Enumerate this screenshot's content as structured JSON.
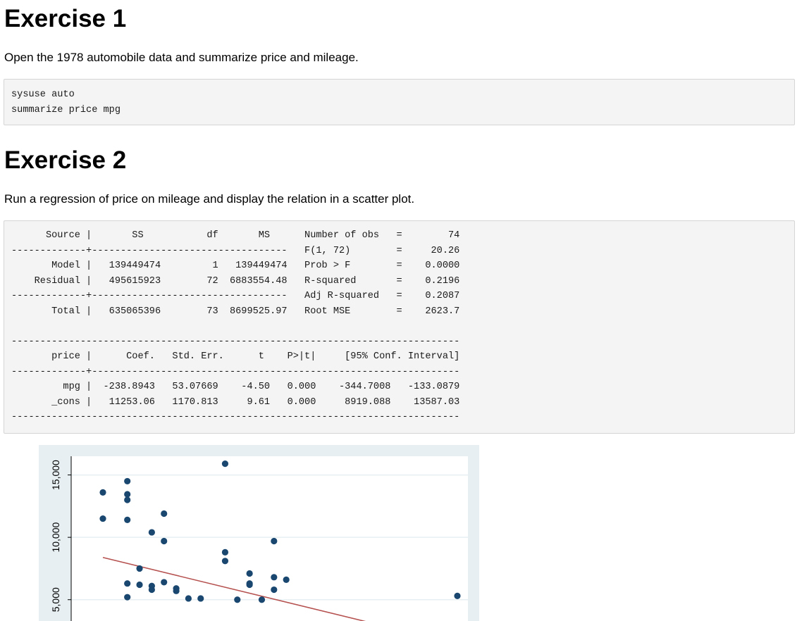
{
  "exercises": [
    {
      "title": "Exercise 1",
      "description": "Open the 1978 automobile data and summarize price and mileage.",
      "code": "sysuse auto\nsummarize price mpg"
    },
    {
      "title": "Exercise 2",
      "description": "Run a regression of price on mileage and display the relation in a scatter plot.",
      "output": "      Source |       SS           df       MS      Number of obs   =        74\n-------------+----------------------------------   F(1, 72)        =     20.26\n       Model |   139449474         1   139449474   Prob > F        =    0.0000\n    Residual |   495615923        72  6883554.48   R-squared       =    0.2196\n-------------+----------------------------------   Adj R-squared   =    0.2087\n       Total |   635065396        73  8699525.97   Root MSE        =    2623.7\n\n------------------------------------------------------------------------------\n       price |      Coef.   Std. Err.      t    P>|t|     [95% Conf. Interval]\n-------------+----------------------------------------------------------------\n         mpg |  -238.8943   53.07669    -4.50   0.000    -344.7008   -133.0879\n       _cons |   11253.06   1170.813     9.61   0.000     8919.088    13587.03\n------------------------------------------------------------------------------"
    }
  ],
  "chart_data": {
    "type": "scatter",
    "title": "",
    "xlabel": "",
    "ylabel": "",
    "yticks": [
      {
        "value": 15000,
        "label": "15,000"
      },
      {
        "value": 10000,
        "label": "10,000"
      },
      {
        "value": 5000,
        "label": "5,000"
      }
    ],
    "xlim": [
      12,
      41
    ],
    "ylim": [
      3291,
      16500
    ],
    "grid": true,
    "marker_color": "#1a476f",
    "fit_line_color": "#b5514f",
    "fit_line": {
      "intercept": 11253.06,
      "slope": -238.8943,
      "x_range": [
        12,
        41
      ]
    },
    "points": [
      {
        "x": 12,
        "y": 13600
      },
      {
        "x": 12,
        "y": 11500
      },
      {
        "x": 14,
        "y": 14500
      },
      {
        "x": 14,
        "y": 13450
      },
      {
        "x": 14,
        "y": 13000
      },
      {
        "x": 14,
        "y": 11400
      },
      {
        "x": 14,
        "y": 6300
      },
      {
        "x": 14,
        "y": 5200
      },
      {
        "x": 15,
        "y": 7500
      },
      {
        "x": 15,
        "y": 6200
      },
      {
        "x": 16,
        "y": 10400
      },
      {
        "x": 16,
        "y": 6100
      },
      {
        "x": 16,
        "y": 5800
      },
      {
        "x": 17,
        "y": 11900
      },
      {
        "x": 17,
        "y": 9700
      },
      {
        "x": 17,
        "y": 6400
      },
      {
        "x": 18,
        "y": 5900
      },
      {
        "x": 18,
        "y": 5700
      },
      {
        "x": 19,
        "y": 5100
      },
      {
        "x": 20,
        "y": 5100
      },
      {
        "x": 22,
        "y": 15900
      },
      {
        "x": 22,
        "y": 8800
      },
      {
        "x": 22,
        "y": 8100
      },
      {
        "x": 23,
        "y": 5000
      },
      {
        "x": 24,
        "y": 7100
      },
      {
        "x": 24,
        "y": 6300
      },
      {
        "x": 24,
        "y": 6200
      },
      {
        "x": 25,
        "y": 5000
      },
      {
        "x": 26,
        "y": 9700
      },
      {
        "x": 26,
        "y": 6800
      },
      {
        "x": 26,
        "y": 5800
      },
      {
        "x": 27,
        "y": 6600
      },
      {
        "x": 41,
        "y": 5300
      }
    ]
  }
}
